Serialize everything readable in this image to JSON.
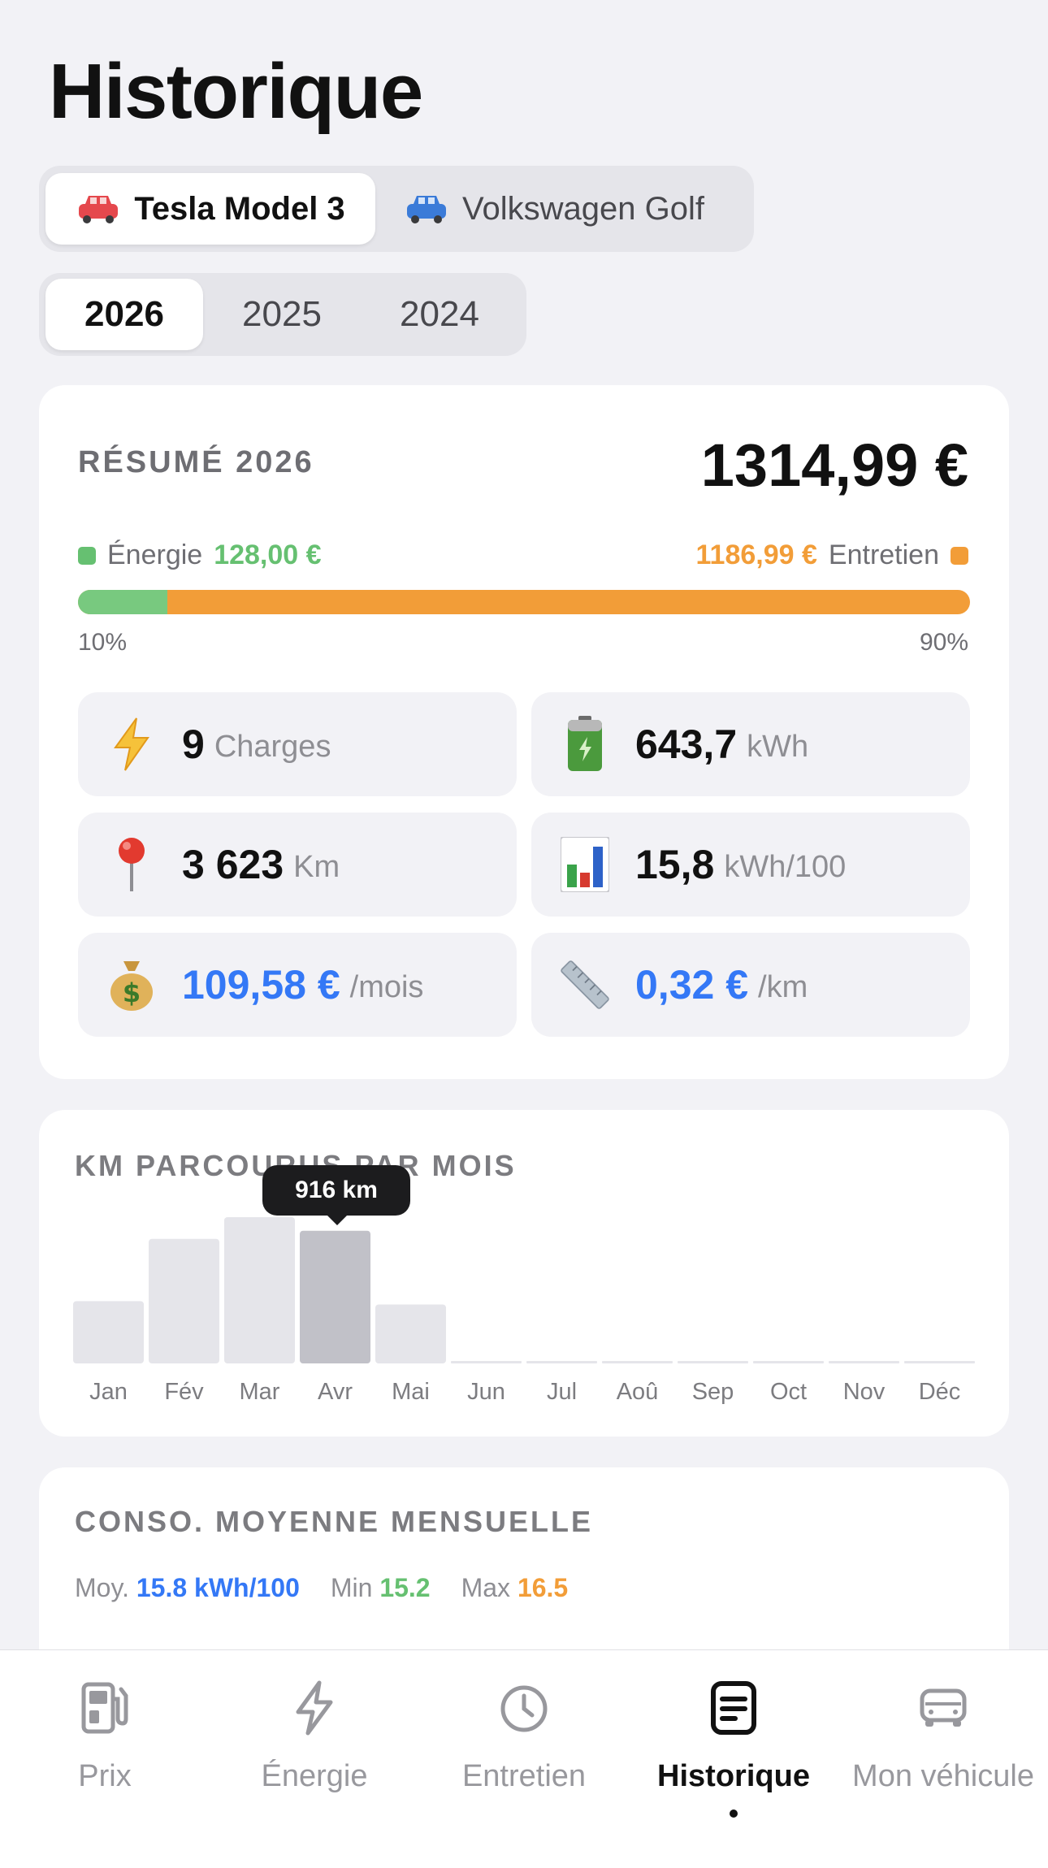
{
  "page": {
    "title": "Historique"
  },
  "vehicles": [
    {
      "label": "Tesla Model 3",
      "color": "#e5484d",
      "active": true
    },
    {
      "label": "Volkswagen Golf",
      "color": "#3b7bd8",
      "active": false
    }
  ],
  "years": [
    {
      "label": "2026",
      "active": true
    },
    {
      "label": "2025",
      "active": false
    },
    {
      "label": "2024",
      "active": false
    }
  ],
  "summary": {
    "label": "RÉSUMÉ 2026",
    "total": "1314,99 €",
    "energy_label": "Énergie",
    "energy_value": "128,00 €",
    "maintenance_label": "Entretien",
    "maintenance_value": "1186,99 €",
    "energy_fraction": 0.1,
    "energy_pct": "10%",
    "maintenance_pct": "90%",
    "colors": {
      "energy": "#78c97f",
      "maintenance": "#f29d38"
    }
  },
  "stats": {
    "charges": {
      "value": "9",
      "unit": "Charges",
      "icon": "lightning-icon"
    },
    "energy": {
      "value": "643,7",
      "unit": "kWh",
      "icon": "battery-icon"
    },
    "distance": {
      "value": "3 623",
      "unit": "Km",
      "icon": "pin-icon"
    },
    "consumption": {
      "value": "15,8",
      "unit": "kWh/100",
      "icon": "bar-chart-icon"
    },
    "monthly": {
      "value": "109,58 €",
      "unit": "/mois",
      "icon": "money-bag-icon"
    },
    "per_km": {
      "value": "0,32 €",
      "unit": "/km",
      "icon": "ruler-icon"
    }
  },
  "chart_data": {
    "type": "bar",
    "title": "KM PARCOURUS PAR MOIS",
    "categories": [
      "Jan",
      "Fév",
      "Mar",
      "Avr",
      "Mai",
      "Jun",
      "Jul",
      "Aoû",
      "Sep",
      "Oct",
      "Nov",
      "Déc"
    ],
    "values": [
      430,
      860,
      1010,
      916,
      407,
      0,
      0,
      0,
      0,
      0,
      0,
      0
    ],
    "highlight_index": 3,
    "tooltip": "916 km",
    "ylim": [
      0,
      1010
    ],
    "grid": false,
    "colors": {
      "bar": "#e5e5ea",
      "highlight": "#c1c1c8"
    }
  },
  "conso": {
    "title": "CONSO. MOYENNE MENSUELLE",
    "avg_label": "Moy.",
    "avg_value": "15.8 kWh/100",
    "min_label": "Min",
    "min_value": "15.2",
    "max_label": "Max",
    "max_value": "16.5"
  },
  "tabs": [
    {
      "label": "Prix",
      "icon": "fuel-pump-icon",
      "active": false
    },
    {
      "label": "Énergie",
      "icon": "lightning-icon",
      "active": false
    },
    {
      "label": "Entretien",
      "icon": "clock-icon",
      "active": false
    },
    {
      "label": "Historique",
      "icon": "document-icon",
      "active": true
    },
    {
      "label": "Mon véhicule",
      "icon": "car-icon",
      "active": false
    }
  ]
}
